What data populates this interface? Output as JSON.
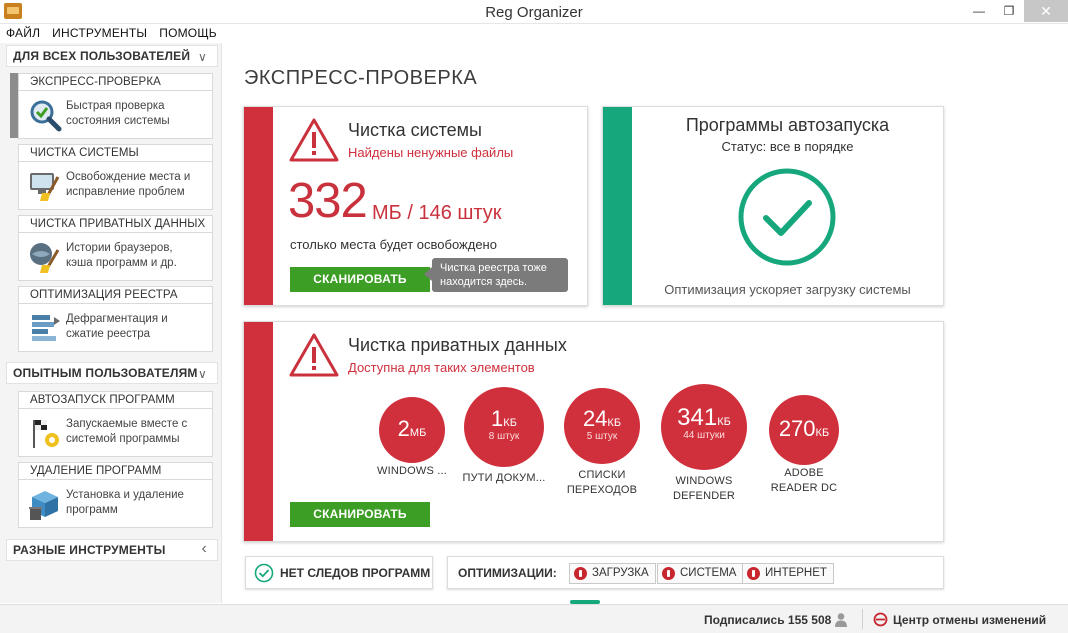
{
  "window": {
    "title": "Reg Organizer",
    "minimize": "—",
    "restore": "❐",
    "close": "✕"
  },
  "menu": [
    "ФАЙЛ",
    "ИНСТРУМЕНТЫ",
    "ПОМОЩЬ"
  ],
  "sidebar": {
    "groups": [
      {
        "label": "ДЛЯ ВСЕХ ПОЛЬЗОВАТЕЛЕЙ",
        "chevron": "∨"
      },
      {
        "label": "ОПЫТНЫМ ПОЛЬЗОВАТЕЛЯМ",
        "chevron": "∨"
      },
      {
        "label": "РАЗНЫЕ ИНСТРУМЕНТЫ",
        "chevron": "‹"
      }
    ],
    "tiles": [
      {
        "title": "ЭКСПРЕСС-ПРОВЕРКА",
        "line1": "Быстрая проверка",
        "line2": "состояния системы",
        "icon": "magnifier-check-icon"
      },
      {
        "title": "ЧИСТКА СИСТЕМЫ",
        "line1": "Освобождение места и",
        "line2": "исправление проблем",
        "icon": "monitor-broom-icon"
      },
      {
        "title": "ЧИСТКА ПРИВАТНЫХ ДАННЫХ",
        "line1": "Истории браузеров,",
        "line2": "кэша программ и др.",
        "icon": "globe-broom-icon"
      },
      {
        "title": "ОПТИМИЗАЦИЯ РЕЕСТРА",
        "line1": "Дефрагментация и",
        "line2": "сжатие реестра",
        "icon": "registry-stack-icon"
      },
      {
        "title": "АВТОЗАПУСК ПРОГРАММ",
        "line1": "Запускаемые вместе с",
        "line2": "системой программы",
        "icon": "flag-gear-icon"
      },
      {
        "title": "УДАЛЕНИЕ ПРОГРАММ",
        "line1": "Установка и удаление",
        "line2": "программ",
        "icon": "box-trash-icon"
      }
    ]
  },
  "main": {
    "title": "ЭКСПРЕСС-ПРОВЕРКА",
    "system_clean": {
      "title": "Чистка системы",
      "subtitle": "Найдены ненужные файлы",
      "number": "332",
      "unit": "МБ / 146 штук",
      "note": "столько места будет освобождено",
      "button": "СКАНИРОВАТЬ",
      "tooltip": "Чистка реестра тоже находится здесь."
    },
    "autorun": {
      "title": "Программы автозапуска",
      "status": "Статус: все в порядке",
      "footer": "Оптимизация ускоряет загрузку системы"
    },
    "private": {
      "title": "Чистка приватных данных",
      "subtitle": "Доступна для таких элементов",
      "button": "СКАНИРОВАТЬ",
      "items": [
        {
          "num": "2",
          "unit": "МБ",
          "count": "",
          "label1": "WINDOWS ...",
          "label2": ""
        },
        {
          "num": "1",
          "unit": "КБ",
          "count": "8 штук",
          "label1": "ПУТИ ДОКУМ...",
          "label2": ""
        },
        {
          "num": "24",
          "unit": "КБ",
          "count": "5 штук",
          "label1": "СПИСКИ",
          "label2": "ПЕРЕХОДОВ"
        },
        {
          "num": "341",
          "unit": "КБ",
          "count": "44 штуки",
          "label1": "WINDOWS",
          "label2": "DEFENDER"
        },
        {
          "num": "270",
          "unit": "КБ",
          "count": "",
          "label1": "ADOBE",
          "label2": "READER DC"
        }
      ]
    },
    "traces": {
      "label": "НЕТ СЛЕДОВ ПРОГРАММ"
    },
    "optimizations": {
      "label": "ОПТИМИЗАЦИИ:",
      "buttons": [
        "ЗАГРУЗКА",
        "СИСТЕМА",
        "ИНТЕРНЕТ"
      ]
    }
  },
  "status": {
    "subscribers": "Подписались 155 508",
    "undo": "Центр отмены изменений"
  },
  "colors": {
    "red": "#d0303c",
    "green": "#17a77d",
    "button_green": "#3d9e26"
  }
}
